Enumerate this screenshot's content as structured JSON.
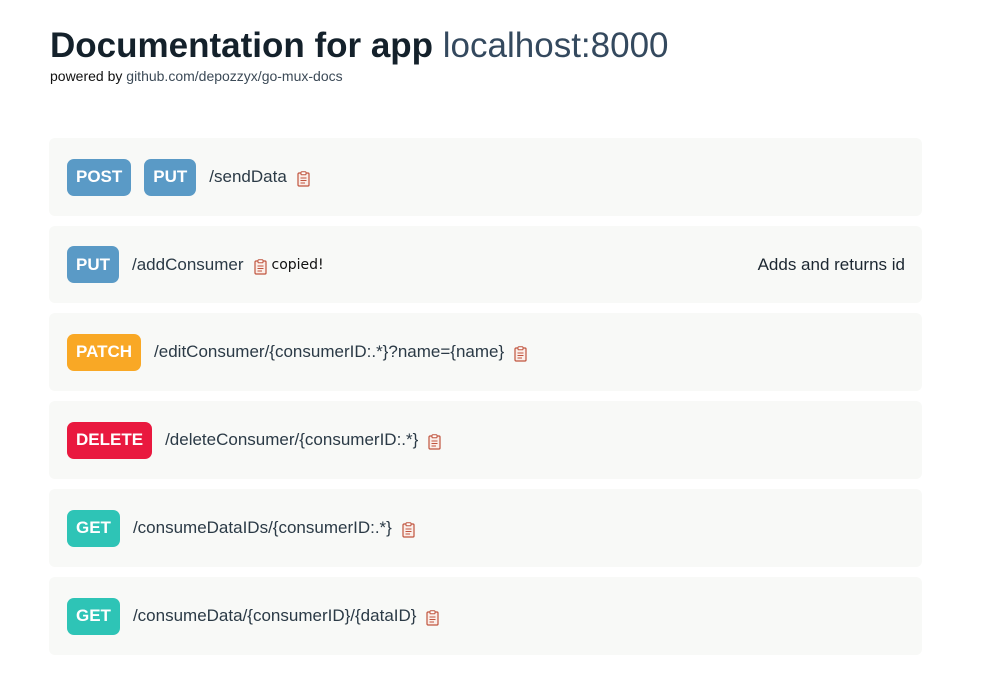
{
  "header": {
    "title_prefix": "Documentation for app ",
    "title_host": "localhost:8000",
    "powered_by": "powered by ",
    "powered_link": "github.com/depozzyx/go-mux-docs"
  },
  "routes": [
    {
      "methods": [
        "POST",
        "PUT"
      ],
      "path": "/sendData",
      "copied": "",
      "description": ""
    },
    {
      "methods": [
        "PUT"
      ],
      "path": "/addConsumer",
      "copied": "copied!",
      "description": "Adds and returns id"
    },
    {
      "methods": [
        "PATCH"
      ],
      "path": "/editConsumer/{consumerID:.*}?name={name}",
      "copied": "",
      "description": ""
    },
    {
      "methods": [
        "DELETE"
      ],
      "path": "/deleteConsumer/{consumerID:.*}",
      "copied": "",
      "description": ""
    },
    {
      "methods": [
        "GET"
      ],
      "path": "/consumeDataIDs/{consumerID:.*}",
      "copied": "",
      "description": ""
    },
    {
      "methods": [
        "GET"
      ],
      "path": "/consumeData/{consumerID}/{dataID}",
      "copied": "",
      "description": ""
    }
  ],
  "colors": {
    "POST": "#5a9ac6",
    "PUT": "#5a9ac6",
    "PATCH": "#f9a825",
    "DELETE": "#e9193f",
    "GET": "#2ec4b6"
  },
  "icons": {
    "copy": "clipboard-icon"
  }
}
